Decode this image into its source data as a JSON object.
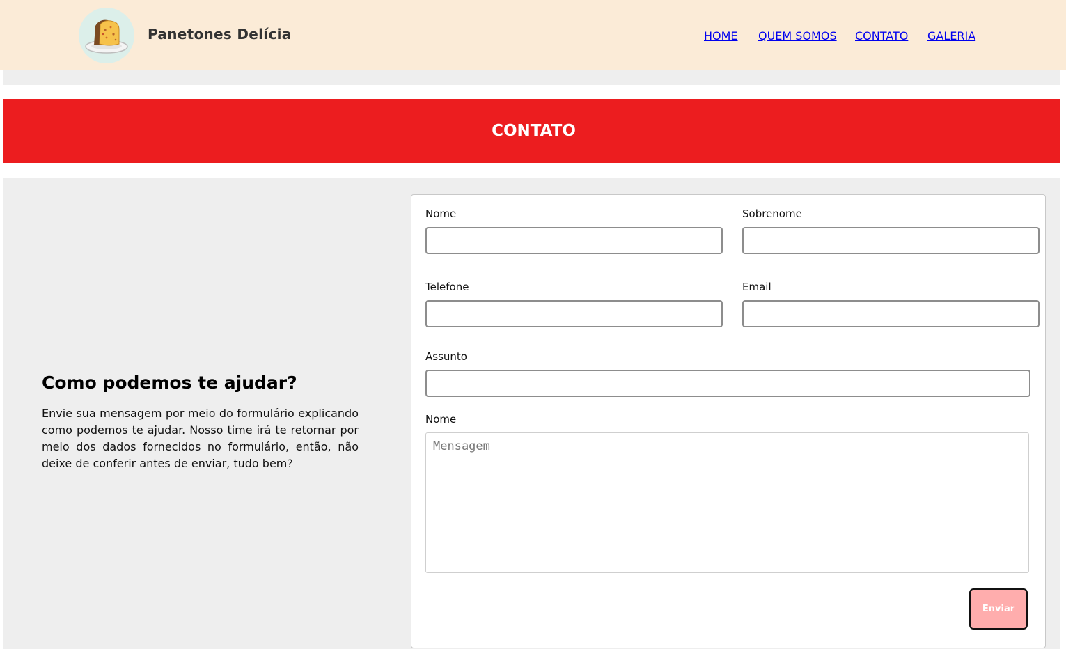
{
  "header": {
    "brand": "Panetones Delícia",
    "logo_icon": "panettone-icon",
    "nav": [
      {
        "label": "HOME"
      },
      {
        "label": "QUEM SOMOS"
      },
      {
        "label": "CONTATO"
      },
      {
        "label": "GALERIA"
      }
    ]
  },
  "banner": {
    "title": "CONTATO"
  },
  "help": {
    "title": "Como podemos te ajudar?",
    "text": "Envie sua mensagem por meio do formulário explicando como podemos te ajudar. Nosso time irá te retornar por meio dos dados fornecidos no formulário, então, não deixe de conferir antes de enviar, tudo bem?"
  },
  "form": {
    "first_name": {
      "label": "Nome",
      "value": ""
    },
    "last_name": {
      "label": "Sobrenome",
      "value": ""
    },
    "phone": {
      "label": "Telefone",
      "value": ""
    },
    "email": {
      "label": "Email",
      "value": ""
    },
    "subject": {
      "label": "Assunto",
      "value": ""
    },
    "message": {
      "label": "Nome",
      "placeholder": "Mensagem",
      "value": ""
    },
    "submit_label": "Enviar"
  },
  "colors": {
    "header_bg": "#fbebd7",
    "banner_bg": "#ec1d1f",
    "page_bg": "#eeeeee",
    "button_bg": "#ffadad"
  }
}
